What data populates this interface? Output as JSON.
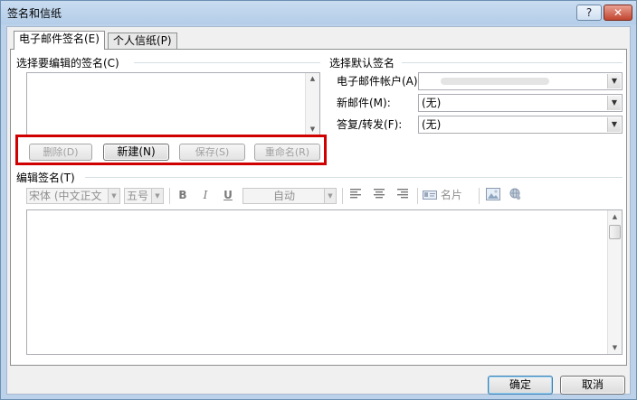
{
  "window": {
    "title": "签名和信纸",
    "help_label": "?",
    "close_label": "✕"
  },
  "tabs": [
    {
      "label": "电子邮件签名(E)",
      "active": true
    },
    {
      "label": "个人信纸(P)",
      "active": false
    }
  ],
  "select_signature": {
    "label": "选择要编辑的签名(C)"
  },
  "buttons": {
    "delete": "删除(D)",
    "new": "新建(N)",
    "save": "保存(S)",
    "rename": "重命名(R)",
    "ok": "确定",
    "cancel": "取消"
  },
  "default_signature": {
    "label": "选择默认签名",
    "account_label": "电子邮件帐户(A):",
    "account_value": "",
    "new_messages_label": "新邮件(M):",
    "new_messages_value": "(无)",
    "replies_label": "答复/转发(F):",
    "replies_value": "(无)"
  },
  "edit_signature": {
    "label": "编辑签名(T)",
    "font": "宋体 (中文正文",
    "size": "五号",
    "bold": "B",
    "italic": "I",
    "underline": "U",
    "color": "自动",
    "business_card": "名片"
  },
  "icons": [
    "question-icon",
    "close-icon",
    "chevron-down-icon",
    "align-left-icon",
    "align-center-icon",
    "align-right-icon",
    "business-card-icon",
    "insert-picture-icon",
    "hyperlink-icon"
  ]
}
